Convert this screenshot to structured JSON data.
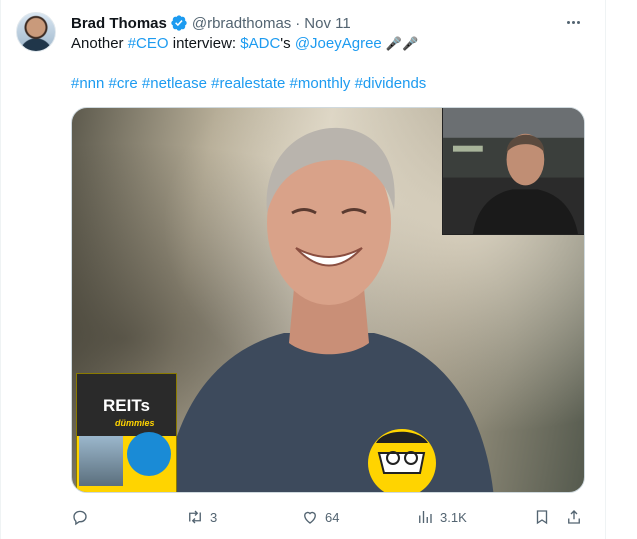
{
  "tweet": {
    "author_name": "Brad Thomas",
    "handle": "@rbradthomas",
    "separator": "·",
    "date": "Nov 11",
    "text_line1": {
      "prefix": "Another ",
      "hashtag_ceo": "#CEO",
      "middle": " interview: ",
      "cashtag": "$ADC",
      "possessive": "'s ",
      "mention": "@JoeyAgree",
      "emoji": " 🎤🎤"
    },
    "hashtags": [
      "#nnn",
      "#cre",
      "#netlease",
      "#realestate",
      "#monthly",
      "#dividends"
    ]
  },
  "media": {
    "book_title": "REITs",
    "book_brand": "dümmies"
  },
  "actions": {
    "replies": "",
    "retweets": "3",
    "likes": "64",
    "views": "3.1K"
  },
  "icons": {
    "verified": "verified-badge-icon",
    "more": "more-icon",
    "reply": "reply-icon",
    "retweet": "retweet-icon",
    "like": "like-icon",
    "views": "views-icon",
    "bookmark": "bookmark-icon",
    "share": "share-icon"
  },
  "colors": {
    "link": "#1d9bf0",
    "secondary_text": "#536471",
    "primary_text": "#0f1419"
  }
}
